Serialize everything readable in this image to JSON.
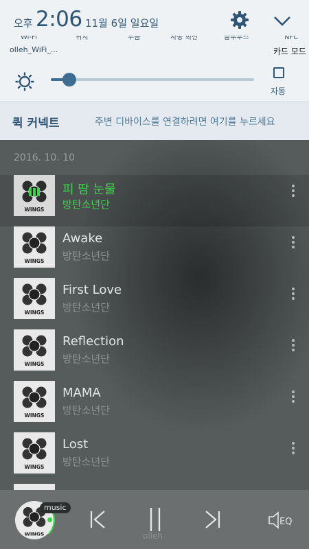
{
  "status": {
    "ampm": "오후",
    "time": "2:06",
    "date": "11월 6일 일요일"
  },
  "toggles": [
    {
      "label": "Wi-Fi",
      "sub": "olleh_WiFi_..."
    },
    {
      "label": "위치",
      "sub": ""
    },
    {
      "label": "무음",
      "sub": ""
    },
    {
      "label": "자동 회전",
      "sub": ""
    },
    {
      "label": "블루투스",
      "sub": ""
    },
    {
      "label": "NFC",
      "sub": "카드 모드"
    }
  ],
  "brightness": {
    "level": 0.09,
    "auto_label": "자동"
  },
  "quick_connect": {
    "title": "퀵 커넥트",
    "description": "주변 디바이스를 연결하려면 여기를 누르세요"
  },
  "playlist": {
    "date": "2016. 10. 10",
    "tracks": [
      {
        "title": "피 땀 눈물",
        "artist": "방탄소년단",
        "active": true
      },
      {
        "title": "Awake",
        "artist": "방탄소년단",
        "active": false
      },
      {
        "title": "First Love",
        "artist": "방탄소년단",
        "active": false
      },
      {
        "title": "Reflection",
        "artist": "방탄소년단",
        "active": false
      },
      {
        "title": "MAMA",
        "artist": "방탄소년단",
        "active": false
      },
      {
        "title": "Lost",
        "artist": "방탄소년단",
        "active": false
      }
    ],
    "album_text": "WINGS"
  },
  "player": {
    "badge": "music",
    "eq_label": "EQ",
    "carrier": "olleh"
  },
  "icons": {
    "settings": "gear-icon",
    "collapse": "chevron-down-icon",
    "brightness": "sun-icon",
    "more": "kebab-icon",
    "prev": "previous-icon",
    "pause": "pause-icon",
    "next": "next-icon",
    "eq": "equalizer-icon"
  },
  "colors": {
    "accent_green": "#3fd14a",
    "shade_text": "#2e5575",
    "player_bg": "#6c6f70"
  }
}
